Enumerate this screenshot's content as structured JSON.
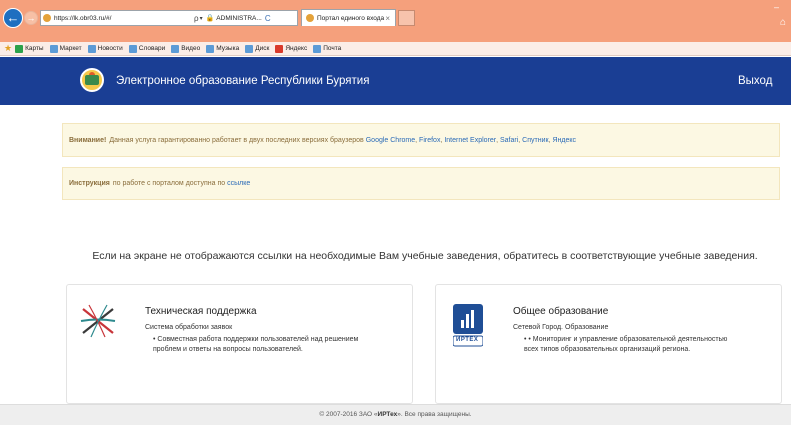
{
  "browser": {
    "url": "https://lk.obr03.ru/#/",
    "address_controls": [
      "ρ",
      "▾",
      "ADMINISTRA...",
      "C"
    ],
    "tab_title": "Портал единого входа",
    "tab_close": "×",
    "win_control": "–",
    "favorites": [
      "Карты",
      "Маркет",
      "Новости",
      "Словари",
      "Видео",
      "Музыка",
      "Диск",
      "Яндекс",
      "Почта"
    ]
  },
  "header": {
    "site_title": "Электронное образование Республики Бурятия",
    "logout_label": "Выход"
  },
  "alerts": {
    "browsers": {
      "strong": "Внимание!",
      "text": "Данная услуга гарантированно работает в двух последних версиях браузеров",
      "links": [
        "Google Chrome",
        "Firefox",
        "Internet Explorer",
        "Safari",
        "Спутник",
        "Яндекс"
      ]
    },
    "instruction": {
      "strong": "Инструкция",
      "text": "по работе с порталом доступна по",
      "link": "ссылке"
    }
  },
  "notice": "Если на экране не отображаются ссылки на необходимые Вам учебные заведения, обратитесь в соответствующие учебные заведения.",
  "cards": [
    {
      "title": "Техническая поддержка",
      "subtitle": "Система обработки заявок",
      "description": "•  Совместная работа поддержки пользователей над решением проблем и ответы на вопросы пользователей."
    },
    {
      "title": "Общее образование",
      "subtitle": "Сетевой Город. Образование",
      "description": "•  • Мониторинг и управление образовательной деятельностью всех типов образовательных организаций региона.",
      "logo_text": "ИРТЕХ"
    }
  ],
  "footer": {
    "prefix": "© 2007-2016 ЗАО «",
    "company": "ИРТех",
    "suffix": "». Все права защищены."
  },
  "colors": {
    "browser_chrome": "#f5a07c",
    "site_header": "#1a3e94",
    "alert_bg": "#fcf8e3",
    "alert_text": "#8a6d3b",
    "link": "#2a6ab7"
  }
}
